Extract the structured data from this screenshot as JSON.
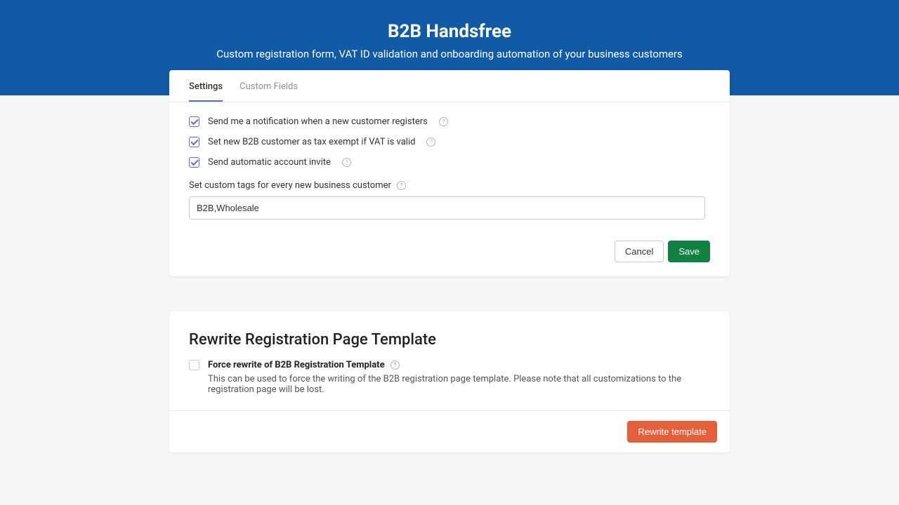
{
  "header": {
    "title": "B2B Handsfree",
    "subtitle": "Custom registration form, VAT ID validation and onboarding automation of your business customers"
  },
  "tabs": {
    "settings": "Settings",
    "custom_fields": "Custom Fields"
  },
  "settings": {
    "notify_label": "Send me a notification when a new customer registers",
    "tax_exempt_label": "Set new B2B customer as tax exempt if VAT is valid",
    "auto_invite_label": "Send automatic account invite",
    "tags_label": "Set custom tags for every new business customer",
    "tags_value": "B2B,Wholesale"
  },
  "buttons": {
    "cancel": "Cancel",
    "save": "Save",
    "rewrite": "Rewrite template"
  },
  "rewrite": {
    "title": "Rewrite Registration Page Template",
    "checkbox_label": "Force rewrite of B2B Registration Template",
    "description": "This can be used to force the writing of the B2B registration page template. Please note that all customizations to the registration page will be lost."
  },
  "help_glyph": "?"
}
